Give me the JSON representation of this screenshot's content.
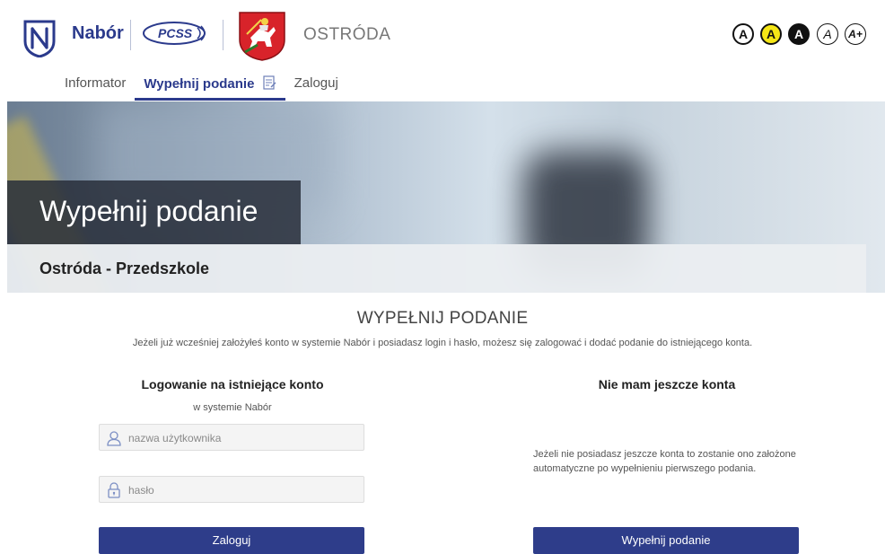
{
  "header": {
    "brand": "Nabór",
    "pcss_logo_text": "PCSS",
    "city": "OSTRÓDA",
    "accessibility": [
      {
        "label": "A",
        "name": "contrast-default"
      },
      {
        "label": "A",
        "name": "contrast-yellow"
      },
      {
        "label": "A",
        "name": "contrast-inverted"
      },
      {
        "label": "A",
        "name": "font-italic"
      },
      {
        "label": "A+",
        "name": "font-larger"
      }
    ]
  },
  "nav": {
    "items": [
      {
        "label": "Informator"
      },
      {
        "label": "Wypełnij podanie"
      },
      {
        "label": "Zaloguj"
      }
    ]
  },
  "hero": {
    "title": "Wypełnij podanie",
    "subtitle": "Ostróda - Przedszkole"
  },
  "content": {
    "heading": "WYPEŁNIJ PODANIE",
    "intro": "Jeżeli już wcześniej założyłeś konto w systemie Nabór i posiadasz login i hasło, możesz się zalogować i dodać podanie do istniejącego konta."
  },
  "login": {
    "title": "Logowanie na istniejące konto",
    "subtitle": "w systemie Nabór",
    "username_placeholder": "nazwa użytkownika",
    "password_placeholder": "hasło",
    "button": "Zaloguj"
  },
  "new_account": {
    "title": "Nie mam jeszcze konta",
    "text": "Jeżeli nie posiadasz jeszcze konta to zostanie ono założone automatyczne po wypełnieniu pierwszego podania.",
    "button": "Wypełnij podanie"
  },
  "colors": {
    "primary": "#2e3d8a",
    "brand": "#2b3a8c",
    "accessibility_yellow": "#f5e616"
  }
}
